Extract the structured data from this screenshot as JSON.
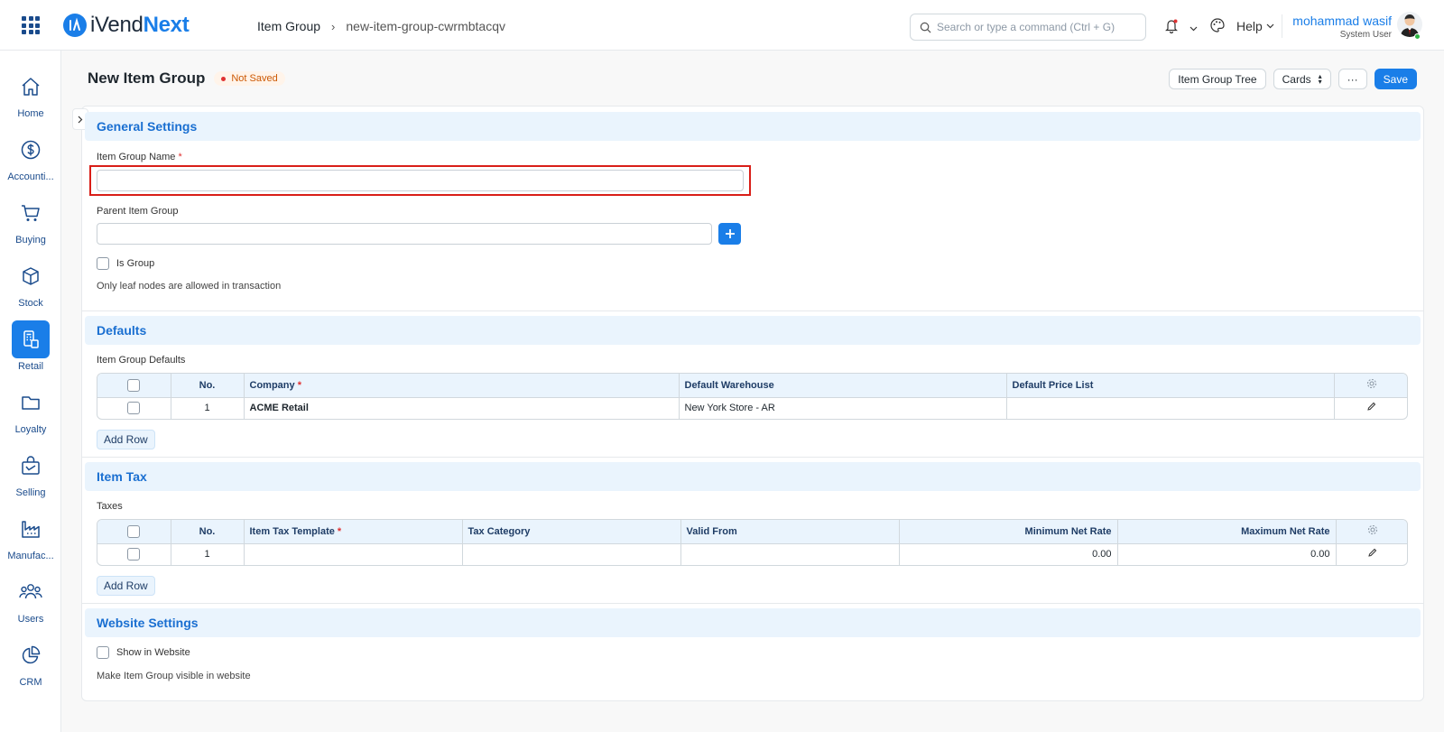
{
  "header": {
    "logo_part1": "iVend",
    "logo_part2": "Next",
    "breadcrumb": [
      "Item Group",
      "new-item-group-cwrmbtacqv"
    ],
    "search_placeholder": "Search or type a command (Ctrl + G)",
    "help_label": "Help",
    "user_name": "mohammad wasif",
    "user_role": "System User"
  },
  "sidebar": {
    "items": [
      {
        "label": "Home",
        "icon": "home-icon"
      },
      {
        "label": "Accounti...",
        "icon": "dollar-icon"
      },
      {
        "label": "Buying",
        "icon": "cart-icon"
      },
      {
        "label": "Stock",
        "icon": "box-icon"
      },
      {
        "label": "Retail",
        "icon": "pos-icon",
        "active": true
      },
      {
        "label": "Loyalty",
        "icon": "folder-icon"
      },
      {
        "label": "Selling",
        "icon": "bag-icon"
      },
      {
        "label": "Manufac...",
        "icon": "factory-icon"
      },
      {
        "label": "Users",
        "icon": "users-icon"
      },
      {
        "label": "CRM",
        "icon": "pie-chart-icon"
      }
    ]
  },
  "page": {
    "title": "New Item Group",
    "status": "Not Saved",
    "actions": {
      "tree": "Item Group Tree",
      "view": "Cards",
      "more": "···",
      "save": "Save"
    }
  },
  "general": {
    "heading": "General Settings",
    "name_label": "Item Group Name",
    "name_value": "",
    "parent_label": "Parent Item Group",
    "parent_value": "",
    "is_group_label": "Is Group",
    "leaf_note": "Only leaf nodes are allowed in transaction"
  },
  "defaults": {
    "heading": "Defaults",
    "table_label": "Item Group Defaults",
    "columns": [
      "No.",
      "Company",
      "Default Warehouse",
      "Default Price List"
    ],
    "rows": [
      {
        "no": "1",
        "company": "ACME Retail",
        "warehouse": "New York Store - AR",
        "price_list": ""
      }
    ],
    "add_row": "Add Row"
  },
  "item_tax": {
    "heading": "Item Tax",
    "table_label": "Taxes",
    "columns": [
      "No.",
      "Item Tax Template",
      "Tax Category",
      "Valid From",
      "Minimum Net Rate",
      "Maximum Net Rate"
    ],
    "rows": [
      {
        "no": "1",
        "template": "",
        "category": "",
        "valid_from": "",
        "min_rate": "0.00",
        "max_rate": "0.00"
      }
    ],
    "add_row": "Add Row"
  },
  "website": {
    "heading": "Website Settings",
    "show_label": "Show in Website",
    "note": "Make Item Group visible in website"
  },
  "colors": {
    "accent": "#1a7ee8",
    "section_bg": "#eaf4fd",
    "error": "#d91e18"
  }
}
